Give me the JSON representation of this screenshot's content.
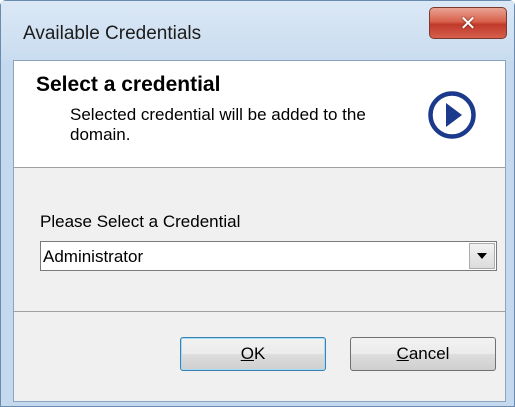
{
  "window": {
    "title": "Available Credentials",
    "close_icon": "close-icon"
  },
  "header": {
    "title": "Select a credential",
    "subtitle": "Selected credential will be added to the domain.",
    "icon": "play-arrow-circle-icon",
    "icon_color": "#1b3a8c"
  },
  "form": {
    "label": "Please Select a Credential",
    "selected_value": "Administrator"
  },
  "buttons": {
    "ok_mnemonic": "O",
    "ok_rest": "K",
    "cancel_mnemonic": "C",
    "cancel_rest": "ancel"
  }
}
